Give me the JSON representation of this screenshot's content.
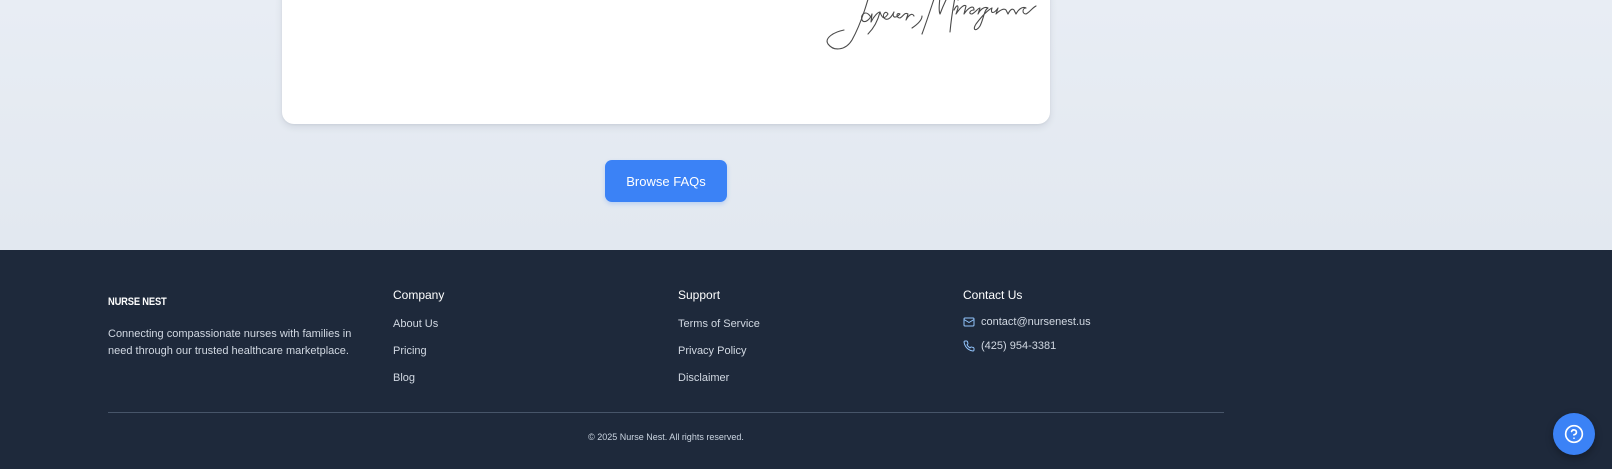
{
  "signature": {
    "text": "Jayson Minagawa"
  },
  "faq_button": {
    "label": "Browse FAQs"
  },
  "footer": {
    "brand": "NURSE NEST",
    "description": "Connecting compassionate nurses with families in need through our trusted healthcare marketplace.",
    "company": {
      "heading": "Company",
      "links": [
        "About Us",
        "Pricing",
        "Blog"
      ]
    },
    "support": {
      "heading": "Support",
      "links": [
        "Terms of Service",
        "Privacy Policy",
        "Disclaimer"
      ]
    },
    "contact": {
      "heading": "Contact Us",
      "email": "contact@nursenest.us",
      "phone": "(425) 954-3381",
      "email_icon": "mail-icon",
      "phone_icon": "phone-icon"
    },
    "copyright": "© 2025 Nurse Nest. All rights reserved."
  },
  "help_button": {
    "icon": "help-circle-icon"
  },
  "colors": {
    "accent": "#3b82f6",
    "footer_bg": "#1e293b",
    "page_bg": "#e2e8f0"
  }
}
